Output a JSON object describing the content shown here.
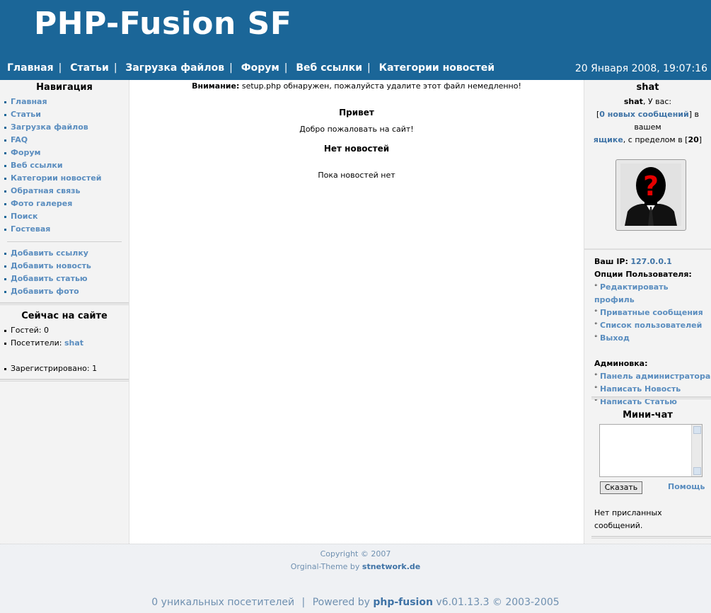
{
  "header": {
    "title": "PHP-Fusion SF",
    "date": "20 Января 2008, 19:07:16",
    "nav": [
      "Главная",
      "Статьи",
      "Загрузка файлов",
      "Форум",
      "Веб ссылки",
      "Категории новостей"
    ],
    "separator": "|"
  },
  "left": {
    "nav_title": "Навигация",
    "nav_items": [
      "Главная",
      "Статьи",
      "Загрузка файлов",
      "FAQ",
      "Форум",
      "Веб ссылки",
      "Категории новостей",
      "Обратная связь",
      "Фото галерея",
      "Поиск",
      "Гостевая"
    ],
    "add_items": [
      "Добавить ссылку",
      "Добавить новость",
      "Добавить статью",
      "Добавить фото"
    ],
    "online_title": "Сейчас на сайте",
    "guests": "Гостей: 0",
    "visitors_label": "Посетители:",
    "visitor_name": "shat",
    "registered": "Зарегистрировано: 1"
  },
  "center": {
    "warning_bold": "Внимание:",
    "warning_text": "setup.php обнаружен, пожалуйста удалите этот файл немедленно!",
    "welcome_title": "Привет",
    "welcome_text": "Добро пожаловать на сайт!",
    "news_title": "Нет новостей",
    "news_text": "Пока новостей нет"
  },
  "right": {
    "user_title": "shat",
    "msg_user": "shat",
    "msg_part1": ", У вас:",
    "msg_open": "[",
    "msg_link": "0 новых сообщений",
    "msg_close": "]",
    "msg_part2": "в вашем",
    "msg_link2": "ящике",
    "msg_part3": ", с пределом в [",
    "msg_limit": "20",
    "msg_end": "]",
    "ip_label": "Ваш IP:",
    "ip_value": "127.0.0.1",
    "options_title": "Опции Пользователя:",
    "options": [
      "Редактировать профиль",
      "Приватные сообщения",
      "Список пользователей",
      "Выход"
    ],
    "admin_title": "Админовка:",
    "admin_items": [
      "Панель администратора",
      "Написать Новость",
      "Написать Статью"
    ],
    "chat_title": "Мини-чат",
    "say_button": "Сказать",
    "help_link": "Помощь",
    "no_messages": "Нет присланных сообщений."
  },
  "footer": {
    "copyright": "Copyright © 2007",
    "theme_prefix": "Orginal-Theme by",
    "theme_link": "stnetwork.de",
    "visitors": "0 уникальных посетителей",
    "sep": "|",
    "powered_prefix": "Powered by",
    "powered_link": "php-fusion",
    "version": "v6.01.13.3 © 2003-2005"
  }
}
